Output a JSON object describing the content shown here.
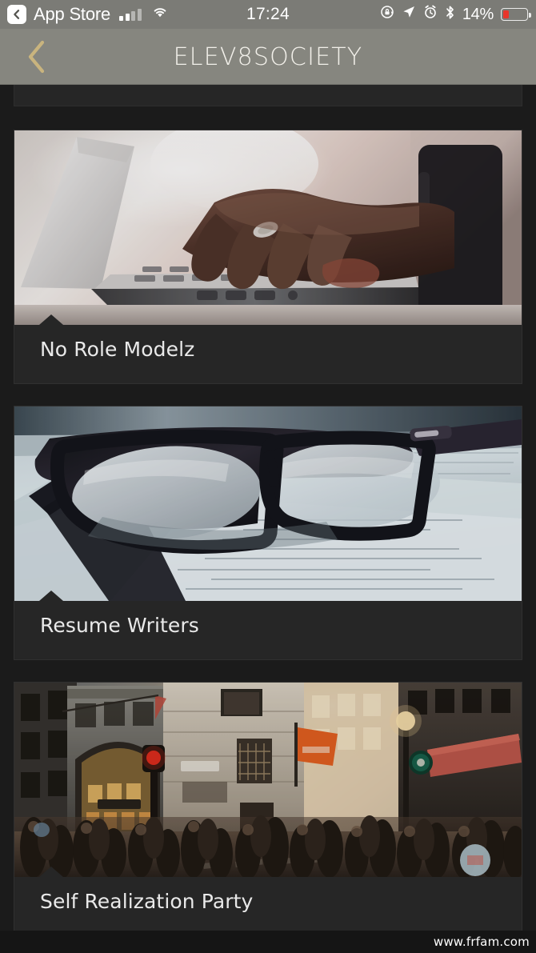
{
  "status_bar": {
    "back_app_label": "App Store",
    "back_chip_icon": "chevron-left-icon",
    "signal_icon": "cellular-signal-icon",
    "signal_bars_filled": 2,
    "signal_bars_total": 4,
    "wifi_icon": "wifi-icon",
    "time": "17:24",
    "rotation_lock_icon": "rotation-lock-icon",
    "location_icon": "location-arrow-icon",
    "alarm_icon": "alarm-clock-icon",
    "bluetooth_icon": "bluetooth-icon",
    "battery_percent": "14%",
    "battery_level": 14,
    "battery_color": "#e8352a",
    "bar_background": "#7b7b76"
  },
  "nav_bar": {
    "back_icon": "chevron-left-icon",
    "back_icon_color": "#c9b47e",
    "title": "ELEV8SOCIETY",
    "background": "#86867f",
    "title_color": "#f2f0ea"
  },
  "theme": {
    "page_background": "#1b1b1b",
    "card_background": "#262626",
    "card_title_color": "#e9e9e9"
  },
  "feed": {
    "partial_card_above": true,
    "cards": [
      {
        "title": "No Role Modelz",
        "image_name": "hands-typing-on-laptop-photo",
        "image_alt": "Close-up of hands typing on a laptop keyboard near a bright window"
      },
      {
        "title": "Resume Writers",
        "image_name": "eyeglasses-on-documents-photo",
        "image_alt": "Black-framed eyeglasses resting on printed paper documents"
      },
      {
        "title": "Self Realization Party",
        "image_name": "crowded-city-street-photo",
        "image_alt": "Crowded city street at sunset with shoppers, storefronts and an orange flag"
      }
    ]
  },
  "watermark": {
    "text": "www.frfam.com"
  }
}
